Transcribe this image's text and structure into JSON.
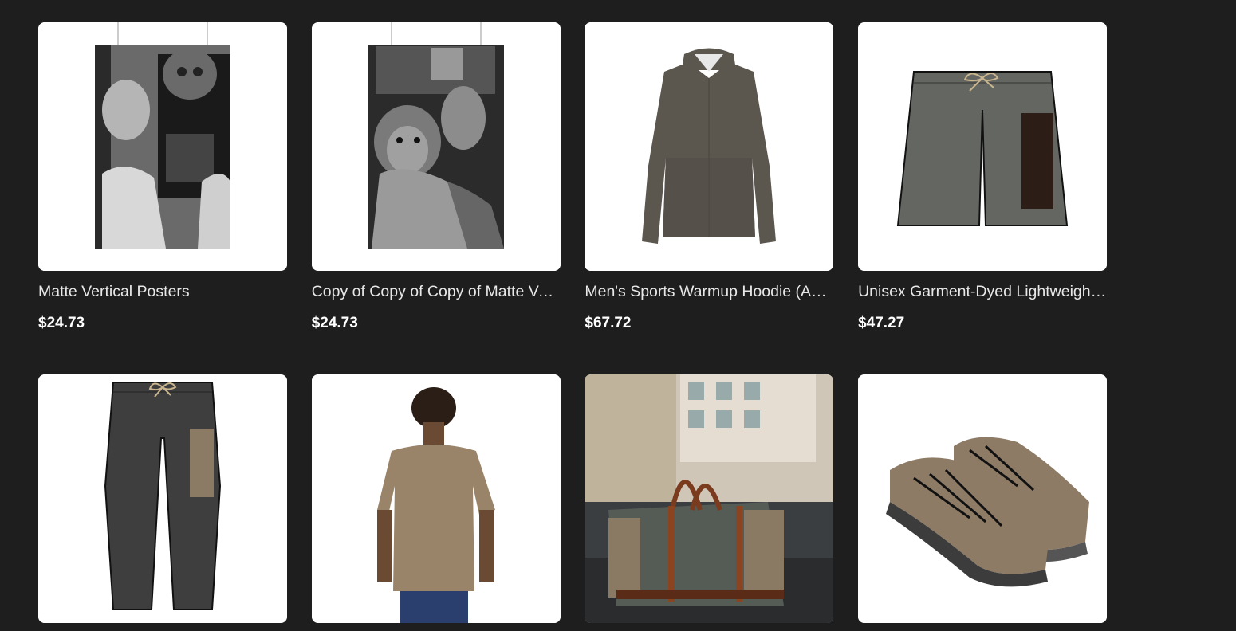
{
  "products": [
    {
      "title": "Matte Vertical Posters",
      "price": "$24.73",
      "image": "poster-portrait-masks"
    },
    {
      "title": "Copy of Copy of Copy of Matte Vertical Posters",
      "price": "$24.73",
      "image": "poster-lion-dog"
    },
    {
      "title": "Men's Sports Warmup Hoodie (AOP)",
      "price": "$67.72",
      "image": "hoodie-olive"
    },
    {
      "title": "Unisex Garment-Dyed Lightweight Shorts",
      "price": "$47.27",
      "image": "shorts-grey"
    },
    {
      "image": "joggers-charcoal"
    },
    {
      "image": "tshirt-tan-back"
    },
    {
      "image": "duffel-bag-street"
    },
    {
      "image": "sneakers-tan"
    }
  ],
  "colors": {
    "background": "#1e1e1e",
    "card": "#ffffff",
    "title": "#e8e8e8",
    "price": "#ffffff"
  }
}
